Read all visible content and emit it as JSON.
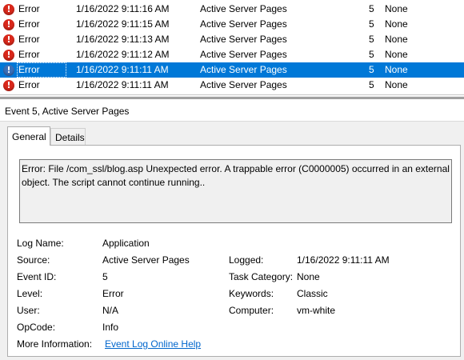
{
  "events": [
    {
      "level": "Error",
      "date": "1/16/2022 9:11:16 AM",
      "source": "Active Server Pages",
      "event_id": "5",
      "task": "None",
      "selected": false
    },
    {
      "level": "Error",
      "date": "1/16/2022 9:11:15 AM",
      "source": "Active Server Pages",
      "event_id": "5",
      "task": "None",
      "selected": false
    },
    {
      "level": "Error",
      "date": "1/16/2022 9:11:13 AM",
      "source": "Active Server Pages",
      "event_id": "5",
      "task": "None",
      "selected": false
    },
    {
      "level": "Error",
      "date": "1/16/2022 9:11:12 AM",
      "source": "Active Server Pages",
      "event_id": "5",
      "task": "None",
      "selected": false
    },
    {
      "level": "Error",
      "date": "1/16/2022 9:11:11 AM",
      "source": "Active Server Pages",
      "event_id": "5",
      "task": "None",
      "selected": true
    },
    {
      "level": "Error",
      "date": "1/16/2022 9:11:11 AM",
      "source": "Active Server Pages",
      "event_id": "5",
      "task": "None",
      "selected": false
    }
  ],
  "event_icon": "error-icon",
  "detail": {
    "header": "Event 5, Active Server Pages",
    "tabs": {
      "general": "General",
      "details": "Details"
    },
    "message": "Error: File /com_ssl/blog.asp  Unexpected error. A trappable error (C0000005) occurred in an external object. The script cannot continue running..",
    "fields": {
      "log_name": {
        "label": "Log Name:",
        "value": "Application"
      },
      "source": {
        "label": "Source:",
        "value": "Active Server Pages"
      },
      "event_id": {
        "label": "Event ID:",
        "value": "5"
      },
      "level": {
        "label": "Level:",
        "value": "Error"
      },
      "user": {
        "label": "User:",
        "value": "N/A"
      },
      "opcode": {
        "label": "OpCode:",
        "value": "Info"
      },
      "logged": {
        "label": "Logged:",
        "value": "1/16/2022 9:11:11 AM"
      },
      "task_category": {
        "label": "Task Category:",
        "value": "None"
      },
      "keywords": {
        "label": "Keywords:",
        "value": "Classic"
      },
      "computer": {
        "label": "Computer:",
        "value": "vm-white"
      },
      "more_info": {
        "label": "More Information:",
        "link": "Event Log Online Help"
      }
    }
  },
  "colors": {
    "selection": "#0078d7",
    "error_icon": "#d9281b",
    "link": "#0066cc"
  }
}
